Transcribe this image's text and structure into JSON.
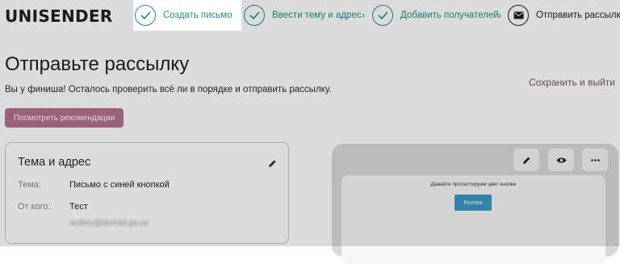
{
  "brand": {
    "logo_text": "UNISENDER"
  },
  "steps": [
    {
      "label": "Создать письмо",
      "icon": "check-icon",
      "status": "done"
    },
    {
      "label": "Ввести тему и адрес",
      "icon": "check-icon",
      "status": "done"
    },
    {
      "label": "Добавить получателей",
      "icon": "check-icon",
      "status": "done"
    },
    {
      "label": "Отправить рассылку",
      "icon": "envelope-icon",
      "status": "current"
    }
  ],
  "page": {
    "title": "Отправьте рассылку",
    "subtitle": "Вы у финиша! Осталось проверить всё ли в порядке и отправить рассылку.",
    "save_exit": "Сохранить и выйти",
    "recommendations_button": "Посмотреть рекомендации"
  },
  "summary_card": {
    "title": "Тема и адрес",
    "subject_label": "Тема:",
    "subject_value": "Письмо с синей кнопкой",
    "from_label": "От кого:",
    "from_value": "Тест",
    "from_email": "andrey@domail.ga.ua"
  },
  "preview": {
    "actions": [
      "pencil-icon",
      "eye-icon",
      "more-icon"
    ],
    "email_heading": "Давайте протестируем цвет кнопки",
    "email_button": "Кнопка"
  },
  "colors": {
    "accent_teal": "#1f8f8f",
    "accent_pink": "#b5708e",
    "email_button_blue": "#3a99c6"
  }
}
